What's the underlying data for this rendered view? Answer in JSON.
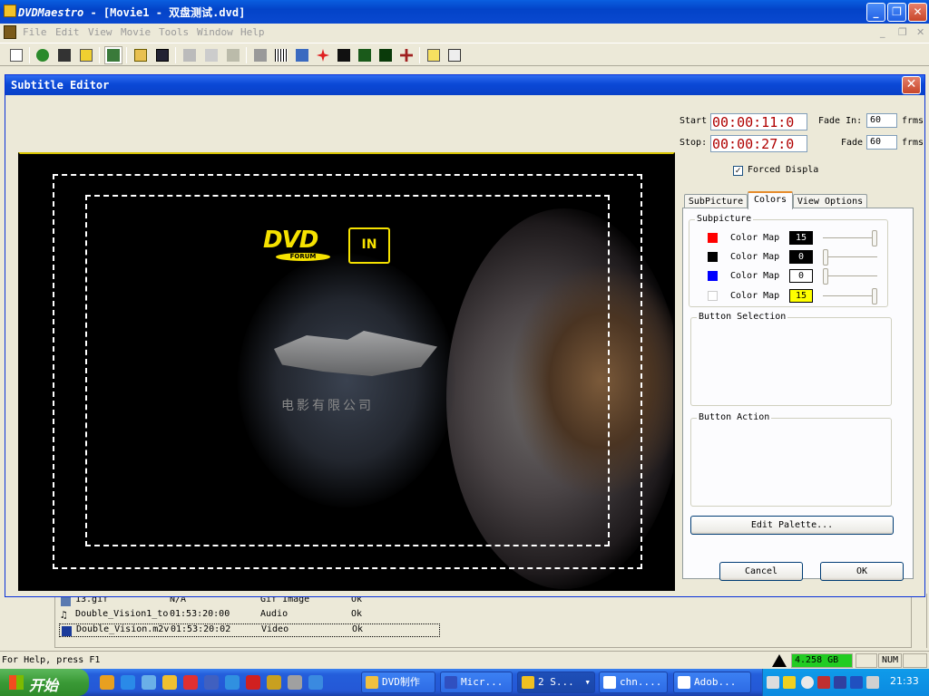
{
  "app": {
    "title_brand": "DVDMaestro",
    "title_rest": " - [Movie1 - 双盘测试.dvd]"
  },
  "menu": [
    "File",
    "Edit",
    "View",
    "Movie",
    "Tools",
    "Window",
    "Help"
  ],
  "toolbar_icons": [
    "new-icon",
    "scene-icon",
    "film-icon",
    "notes-icon",
    "tree-icon",
    "open-icon",
    "save-icon",
    "cut-icon",
    "copy-icon",
    "paste-icon",
    "import-icon",
    "barcode-icon",
    "grid-icon",
    "star-icon",
    "compile-icon",
    "check-icon",
    "build-icon",
    "move-icon",
    "help-icon",
    "context-help-icon"
  ],
  "background_list": {
    "rows": [
      {
        "name": "13.gif",
        "time": "N/A",
        "type": "Gif Image",
        "status": "Ok"
      },
      {
        "name": "Double_Vision1_to",
        "time": "01:53:20:00",
        "type": "Audio",
        "status": "Ok"
      },
      {
        "name": "Double_Vision.m2v",
        "time": "01:53:20:02",
        "type": "Video",
        "status": "Ok"
      }
    ]
  },
  "dialog": {
    "title": "Subtitle Editor",
    "start_label": "Start",
    "start_value": "00:00:11:0",
    "stop_label": "Stop:",
    "stop_value": "00:00:27:0",
    "fade_in_label": "Fade In:",
    "fade_in_value": "60",
    "fade_out_label": "Fade",
    "fade_out_value": "60",
    "frms": "frms",
    "forced_display_label": "Forced Displa",
    "forced_display_checked": true,
    "tabs": [
      "SubPicture",
      "Colors",
      "View Options"
    ],
    "active_tab": "Colors",
    "subpicture_group": "Subpicture",
    "color_maps": [
      {
        "label": "Color Map",
        "swatch": "#ff0000",
        "value": "15",
        "value_bg": "#000000",
        "value_fg": "#ffffff",
        "level": 1.0
      },
      {
        "label": "Color Map",
        "swatch": "#000000",
        "value": "0",
        "value_bg": "#000000",
        "value_fg": "#ffffff",
        "level": 0.0
      },
      {
        "label": "Color Map",
        "swatch": "#0000ff",
        "value": "0",
        "value_bg": "#ffffff",
        "value_fg": "#000000",
        "level": 0.0
      },
      {
        "label": "Color Map",
        "swatch": "#ffffff",
        "value": "15",
        "value_bg": "#ffff00",
        "value_fg": "#000000",
        "level": 1.0
      }
    ],
    "button_selection_group": "Button Selection",
    "button_action_group": "Button Action",
    "edit_palette_label": "Edit Palette...",
    "cancel_label": "Cancel",
    "ok_label": "OK",
    "video": {
      "dvd_logo_text": "DVD",
      "dvd_logo_sub": "FORUM",
      "dvd_in_text": "IN",
      "studio_subtitle": "电影有限公司",
      "subtitle": ""
    }
  },
  "status": {
    "help_text": "For Help, press F1",
    "disk_free": "4.258 GB",
    "num": "NUM"
  },
  "taskbar": {
    "start_label": "开始",
    "tasks": [
      "DVD制作",
      "Micr...",
      "2 S...",
      "chn....",
      "Adob..."
    ],
    "active_task": "2 S...",
    "clock": "21:33"
  }
}
